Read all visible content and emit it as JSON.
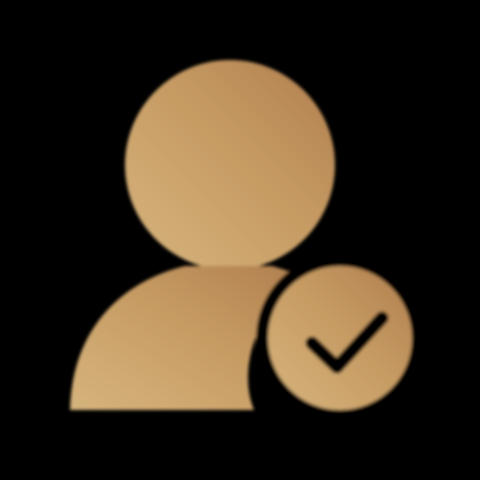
{
  "icon": {
    "name": "user-verified-icon",
    "parts": [
      "user-silhouette-icon",
      "check-badge-icon",
      "checkmark-icon"
    ]
  },
  "colors": {
    "background": "#000000",
    "gold_light": "#D6B47C",
    "gold_mid": "#C69B63",
    "gold_dark": "#B07E4E",
    "check_stroke": "#000000"
  }
}
